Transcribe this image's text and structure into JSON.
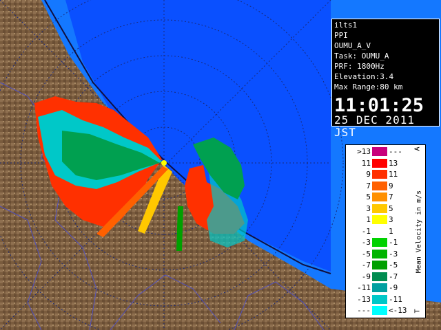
{
  "info": {
    "station": "ilts1",
    "scan_type": "PPI",
    "product": "OUMU_A_V",
    "task": "Task: OUMU_A",
    "prf": "PRF: 1800Hz",
    "elevation": "Elevation:3.4",
    "max_range": "Max Range:80 km",
    "time": "11:01:25",
    "date": "25 DEC 2011 JST"
  },
  "legend": {
    "title": "Mean Velocity in m/s",
    "top_marker": "A",
    "bottom_marker": "T",
    "rows": [
      {
        "left": ">13",
        "right": "---",
        "color": "#c8007c"
      },
      {
        "left": "11",
        "right": "13",
        "color": "#ff0000"
      },
      {
        "left": "9",
        "right": "11",
        "color": "#ff3000"
      },
      {
        "left": "7",
        "right": "9",
        "color": "#ff6000"
      },
      {
        "left": "5",
        "right": "7",
        "color": "#ff9000"
      },
      {
        "left": "3",
        "right": "5",
        "color": "#ffc800"
      },
      {
        "left": "1",
        "right": "3",
        "color": "#ffff00"
      },
      {
        "left": "-1",
        "right": "1",
        "color": "#ffffff"
      },
      {
        "left": "-3",
        "right": "-1",
        "color": "#00d200"
      },
      {
        "left": "-5",
        "right": "-3",
        "color": "#00b400"
      },
      {
        "left": "-7",
        "right": "-5",
        "color": "#00a000"
      },
      {
        "left": "-9",
        "right": "-7",
        "color": "#008c50"
      },
      {
        "left": "-11",
        "right": "-9",
        "color": "#00a0a0"
      },
      {
        "left": "-13",
        "right": "-11",
        "color": "#00c8c8"
      },
      {
        "left": "---",
        "right": "<-13",
        "color": "#00ffff"
      }
    ]
  },
  "colors": {
    "sea": "#0a50ff",
    "sea_far": "#1478ff",
    "land": "#8a6a4a",
    "rings": "#1a2a7a"
  }
}
